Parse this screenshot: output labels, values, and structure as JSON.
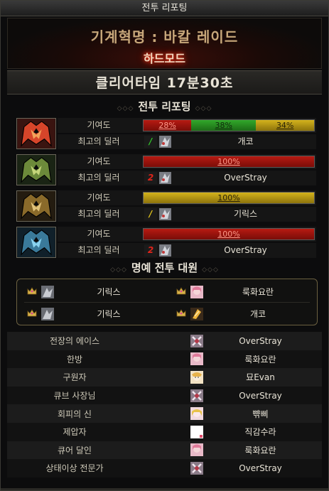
{
  "window": {
    "title": "전투 리포팅"
  },
  "raid": {
    "name": "기계혁명 : 바칼 레이드",
    "difficulty": "하드모드"
  },
  "clear": {
    "text": "클리어타임  17분30초"
  },
  "report": {
    "section_title": "전투 리포팅",
    "contribution_label": "기여도",
    "best_dealer_label": "최고의 딜러",
    "parties": [
      {
        "crest": "red-mech-crest",
        "contribution": [
          {
            "label": "28%",
            "value": 28,
            "color": "red"
          },
          {
            "label": "38%",
            "value": 38,
            "color": "green"
          },
          {
            "label": "34%",
            "value": 34,
            "color": "gold"
          }
        ],
        "badge_text": "/",
        "badge_color": "#32c32a",
        "dealer_icon": "character-portrait",
        "dealer": "개코"
      },
      {
        "crest": "green-mech-crest",
        "contribution": [
          {
            "label": "100%",
            "value": 100,
            "color": "red"
          }
        ],
        "badge_text": "2",
        "badge_color": "#e0241a",
        "dealer_icon": "character-portrait",
        "dealer": "OverStray"
      },
      {
        "crest": "gold-mech-crest",
        "contribution": [
          {
            "label": "100%",
            "value": 100,
            "color": "gold"
          }
        ],
        "badge_text": "/",
        "badge_color": "#e3c51a",
        "dealer_icon": "character-portrait",
        "dealer": "기릭스"
      },
      {
        "crest": "blue-mech-crest",
        "contribution": [
          {
            "label": "100%",
            "value": 100,
            "color": "red"
          }
        ],
        "badge_text": "2",
        "badge_color": "#e0241a",
        "dealer_icon": "character-portrait",
        "dealer": "OverStray"
      }
    ]
  },
  "honor": {
    "section_title": "명예 전투 대원",
    "members": [
      {
        "name": "기릭스",
        "icon": "crown-icon"
      },
      {
        "name": "룩화요란",
        "icon": "crown-icon"
      },
      {
        "name": "기릭스",
        "icon": "crown-icon"
      },
      {
        "name": "개코",
        "icon": "crown-icon"
      }
    ]
  },
  "awards": [
    {
      "title": "전장의 에이스",
      "name": "OverStray"
    },
    {
      "title": "한방",
      "name": "룩화요란"
    },
    {
      "title": "구원자",
      "name": "묘Evan"
    },
    {
      "title": "큐브 사장님",
      "name": "OverStray"
    },
    {
      "title": "회피의 신",
      "name": "뺚삐"
    },
    {
      "title": "제압자",
      "name": "직감수라"
    },
    {
      "title": "큐어 달인",
      "name": "룩화요란"
    },
    {
      "title": "상태이상 전문가",
      "name": "OverStray"
    }
  ],
  "colors": {
    "red": "#b71a12",
    "green": "#31a82a",
    "gold": "#d4b31c",
    "accent_glow": "#ff3a1a"
  }
}
